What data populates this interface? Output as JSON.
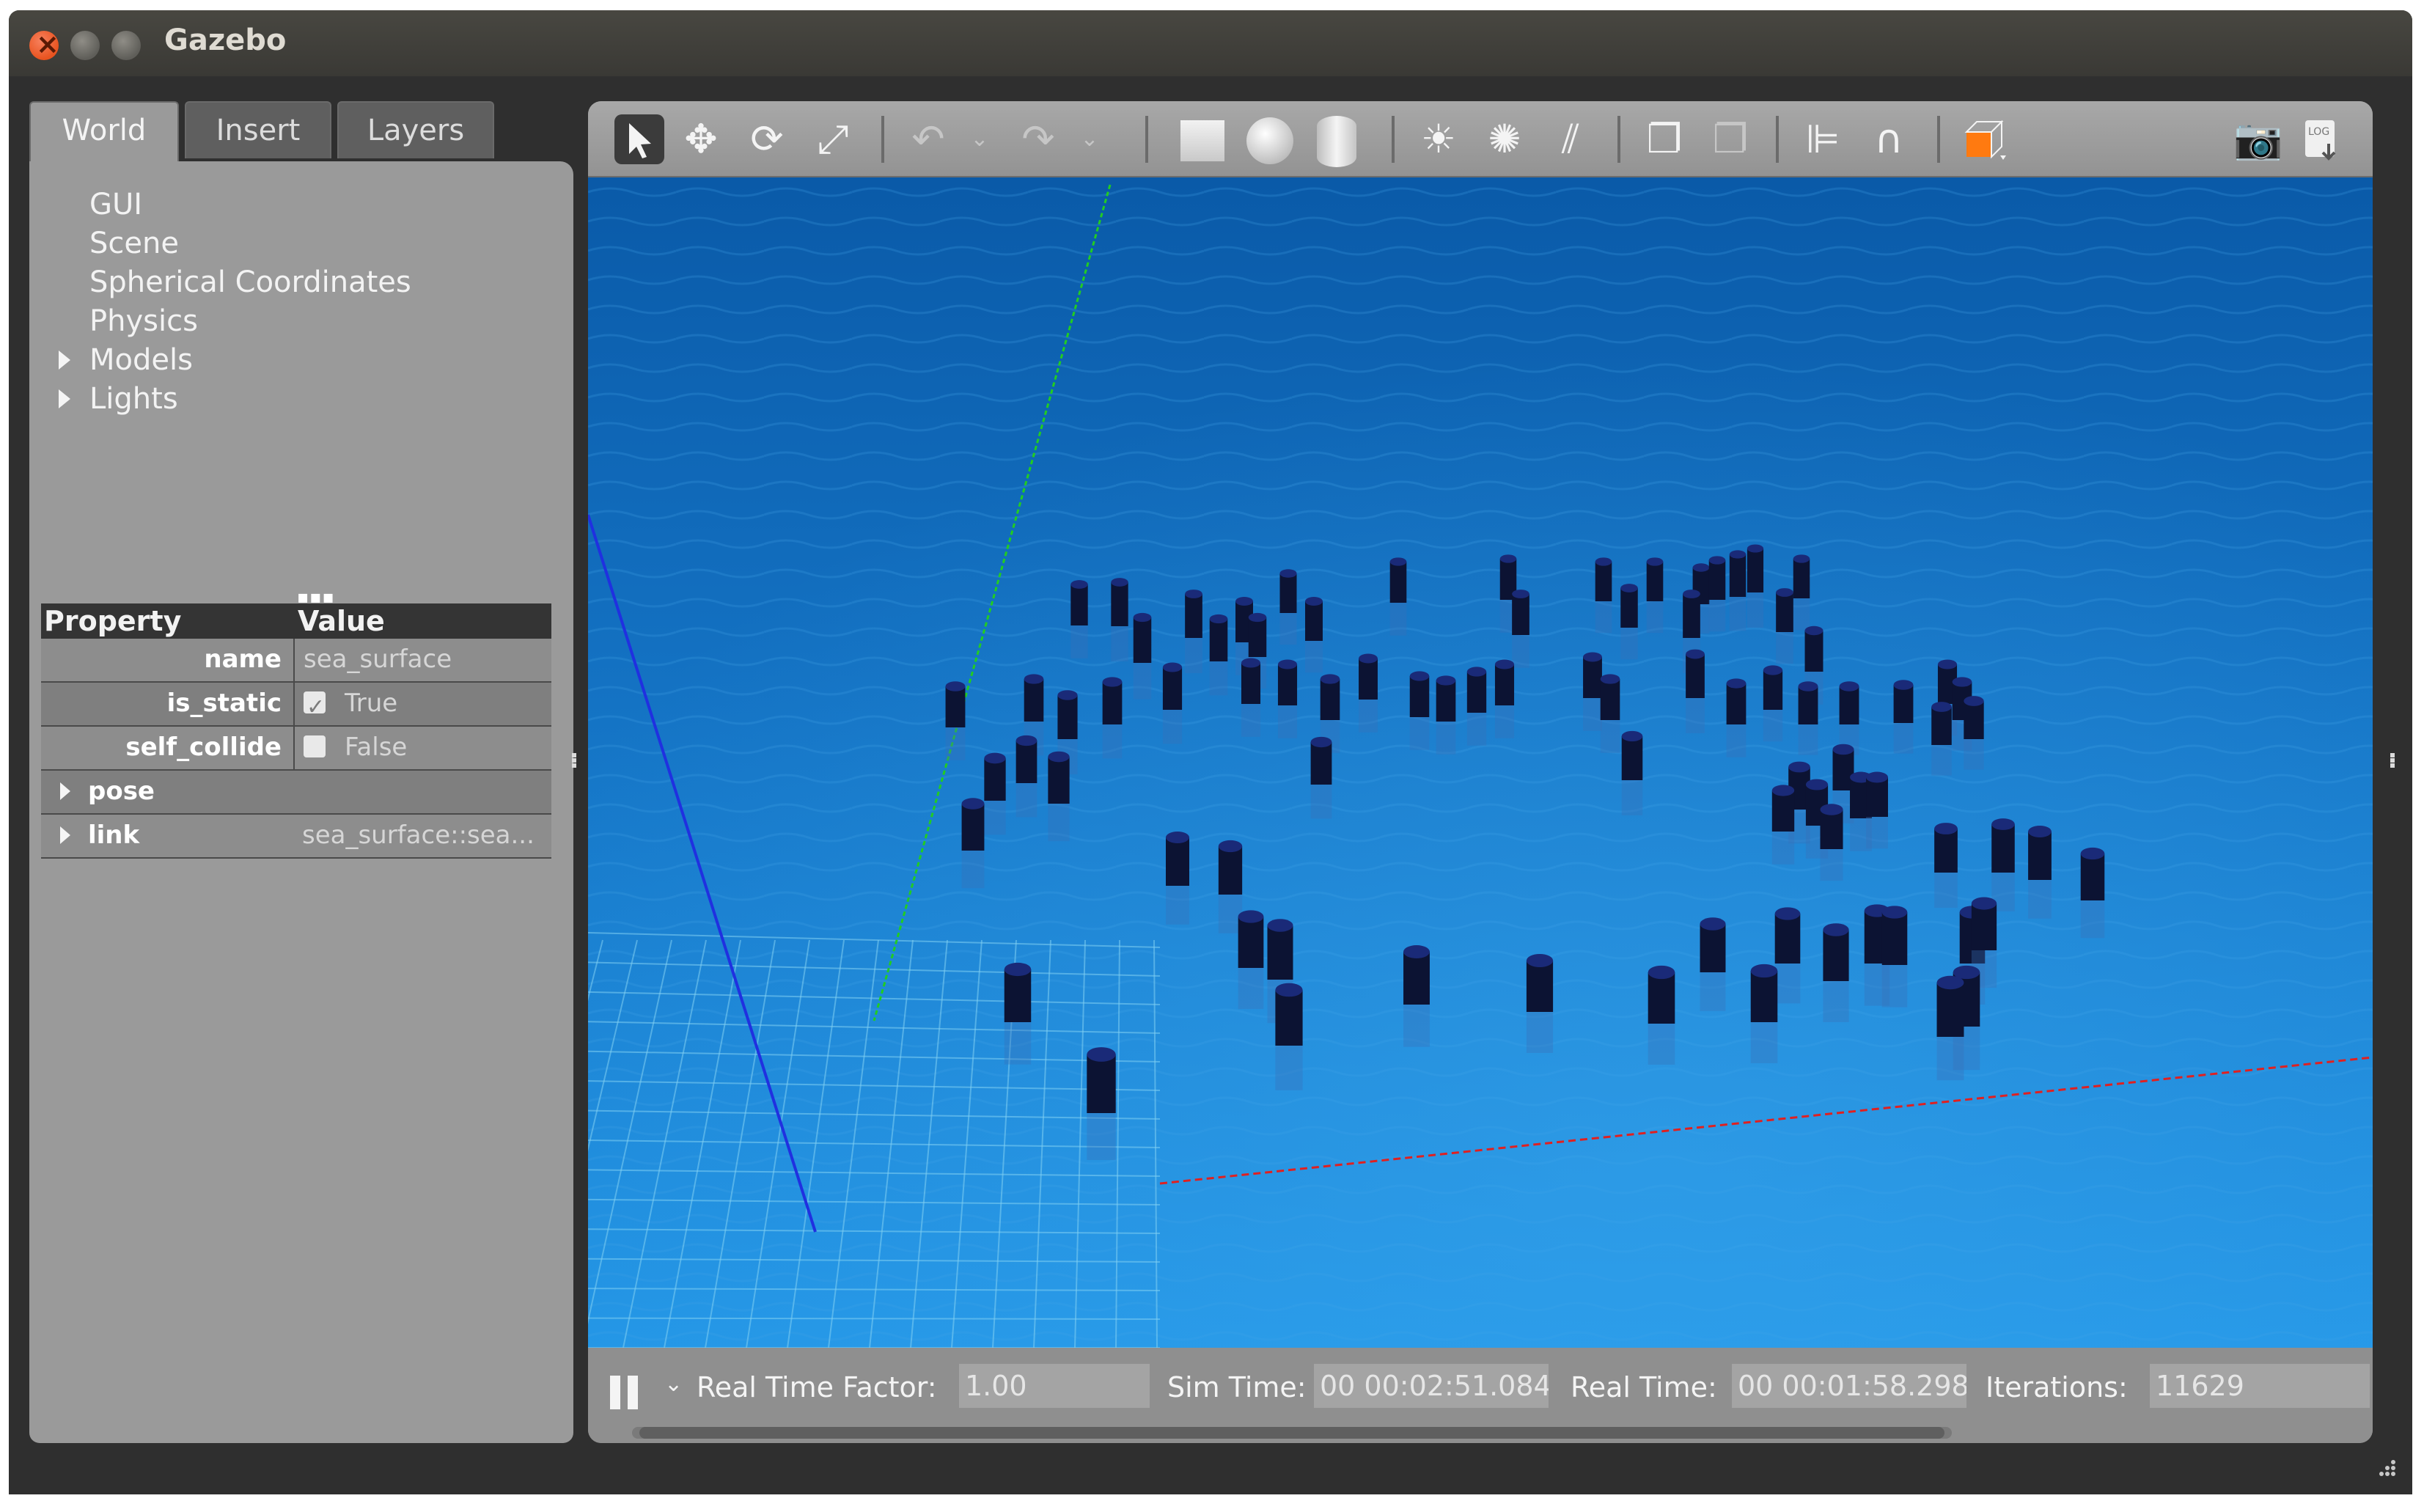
{
  "window": {
    "title": "Gazebo"
  },
  "tabs": {
    "world": "World",
    "insert": "Insert",
    "layers": "Layers"
  },
  "world_tree": {
    "items": [
      "GUI",
      "Scene",
      "Spherical Coordinates",
      "Physics"
    ],
    "expandable": [
      "Models",
      "Lights"
    ]
  },
  "properties": {
    "header_property": "Property",
    "header_value": "Value",
    "name_label": "name",
    "name_value": "sea_surface",
    "is_static_label": "is_static",
    "is_static_value": "True",
    "self_collide_label": "self_collide",
    "self_collide_value": "False",
    "pose_label": "pose",
    "link_label": "link",
    "link_value": "sea_surface::sea..."
  },
  "toolbar": {
    "icons": [
      "select-arrow-icon",
      "translate-icon",
      "rotate-icon",
      "scale-icon",
      "undo-icon",
      "redo-icon",
      "box-icon",
      "sphere-icon",
      "cylinder-icon",
      "point-light-icon",
      "spot-light-icon",
      "directional-light-icon",
      "copy-icon",
      "paste-icon",
      "align-icon",
      "snap-icon",
      "view-angle-icon",
      "screenshot-icon",
      "log-icon"
    ]
  },
  "status_bar": {
    "rtf_label": "Real Time Factor:",
    "rtf_value": "1.00",
    "sim_time_label": "Sim Time:",
    "sim_time_value": "00 00:02:51.084",
    "real_time_label": "Real Time:",
    "real_time_value": "00 00:01:58.298",
    "iterations_label": "Iterations:",
    "iterations_value": "11629"
  },
  "colors": {
    "water": "#1d82d2",
    "water_dark": "#0a5aa8",
    "cylinder": "#0c1333",
    "axis_x": "#e02020",
    "axis_y": "#22cc22",
    "axis_z": "#2030e0",
    "panel_gray": "#9a9a9a"
  }
}
